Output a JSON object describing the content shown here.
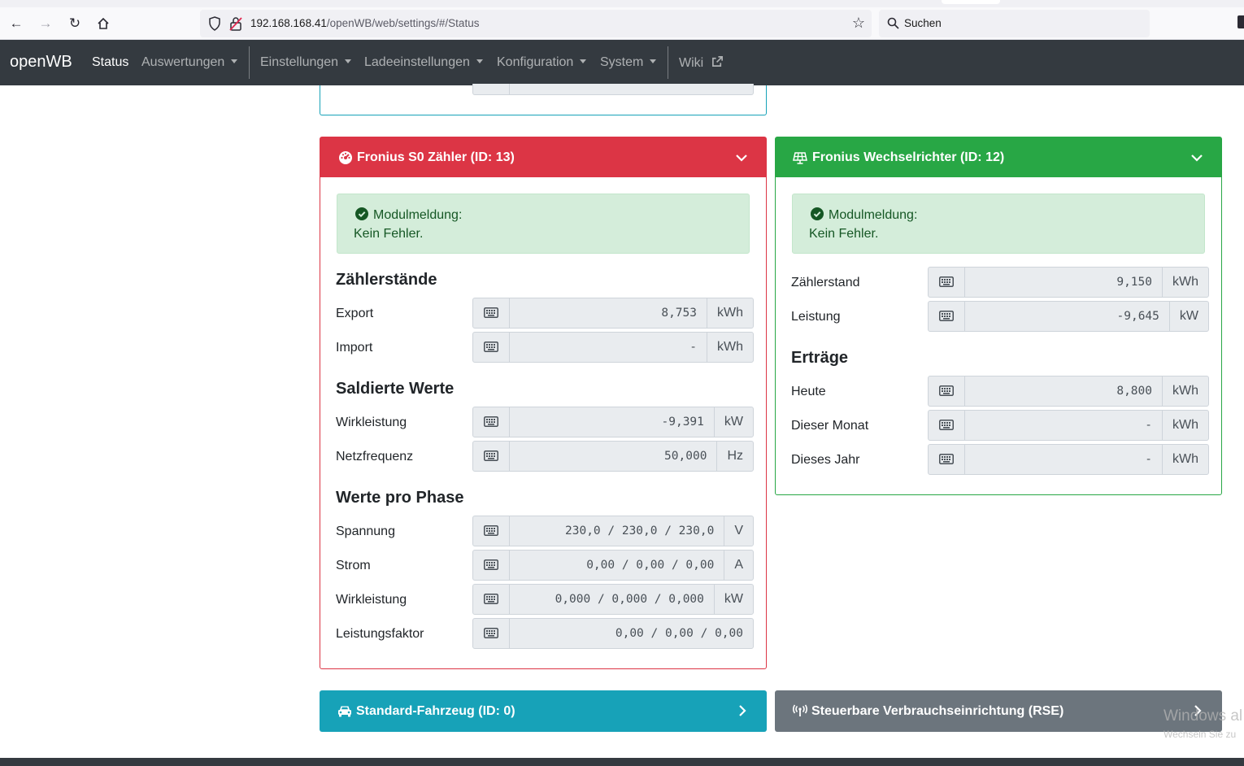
{
  "browser": {
    "url_host": "192.168.168.41",
    "url_path": "/openWB/web/settings/#/Status",
    "search_placeholder": "Suchen"
  },
  "navbar": {
    "brand": "openWB",
    "items": [
      {
        "label": "Status"
      },
      {
        "label": "Auswertungen"
      },
      {
        "label": "Einstellungen"
      },
      {
        "label": "Ladeeinstellungen"
      },
      {
        "label": "Konfiguration"
      },
      {
        "label": "System"
      },
      {
        "label": "Wiki"
      }
    ]
  },
  "counter_card": {
    "title": "Fronius S0 Zähler (ID: 13)",
    "color": "#dc3545",
    "alert_title": "Modulmeldung:",
    "alert_text": "Kein Fehler.",
    "sections": [
      {
        "heading": "Zählerstände"
      },
      {
        "heading": "Saldierte Werte"
      },
      {
        "heading": "Werte pro Phase"
      }
    ],
    "rows": [
      {
        "label": "Export",
        "value": "8,753",
        "unit": "kWh"
      },
      {
        "label": "Import",
        "value": "-",
        "unit": "kWh"
      },
      {
        "label": "Wirkleistung",
        "value": "-9,391",
        "unit": "kW"
      },
      {
        "label": "Netzfrequenz",
        "value": "50,000",
        "unit": "Hz"
      },
      {
        "label": "Spannung",
        "value": "230,0 / 230,0 / 230,0",
        "unit": "V"
      },
      {
        "label": "Strom",
        "value": "0,00 / 0,00 / 0,00",
        "unit": "A"
      },
      {
        "label": "Wirkleistung",
        "value": "0,000 / 0,000 / 0,000",
        "unit": "kW"
      },
      {
        "label": "Leistungsfaktor",
        "value": "0,00 / 0,00 / 0,00",
        "unit": ""
      }
    ]
  },
  "inverter_card": {
    "title": "Fronius Wechselrichter (ID: 12)",
    "color": "#28a745",
    "alert_title": "Modulmeldung:",
    "alert_text": "Kein Fehler.",
    "sections": [
      {
        "heading": "Erträge"
      }
    ],
    "rows": [
      {
        "label": "Zählerstand",
        "value": "9,150",
        "unit": "kWh"
      },
      {
        "label": "Leistung",
        "value": "-9,645",
        "unit": "kW"
      },
      {
        "label": "Heute",
        "value": "8,800",
        "unit": "kWh"
      },
      {
        "label": "Dieser Monat",
        "value": "-",
        "unit": "kWh"
      },
      {
        "label": "Dieses Jahr",
        "value": "-",
        "unit": "kWh"
      }
    ]
  },
  "bottom_cards": [
    {
      "title": "Standard-Fahrzeug (ID: 0)",
      "color": "#17a2b8"
    },
    {
      "title": "Steuerbare Verbrauchseinrichtung (RSE)",
      "color": "#6c757d"
    }
  ],
  "watermark": {
    "line1": "Windows al",
    "line2": "Wechseln Sie zu"
  }
}
